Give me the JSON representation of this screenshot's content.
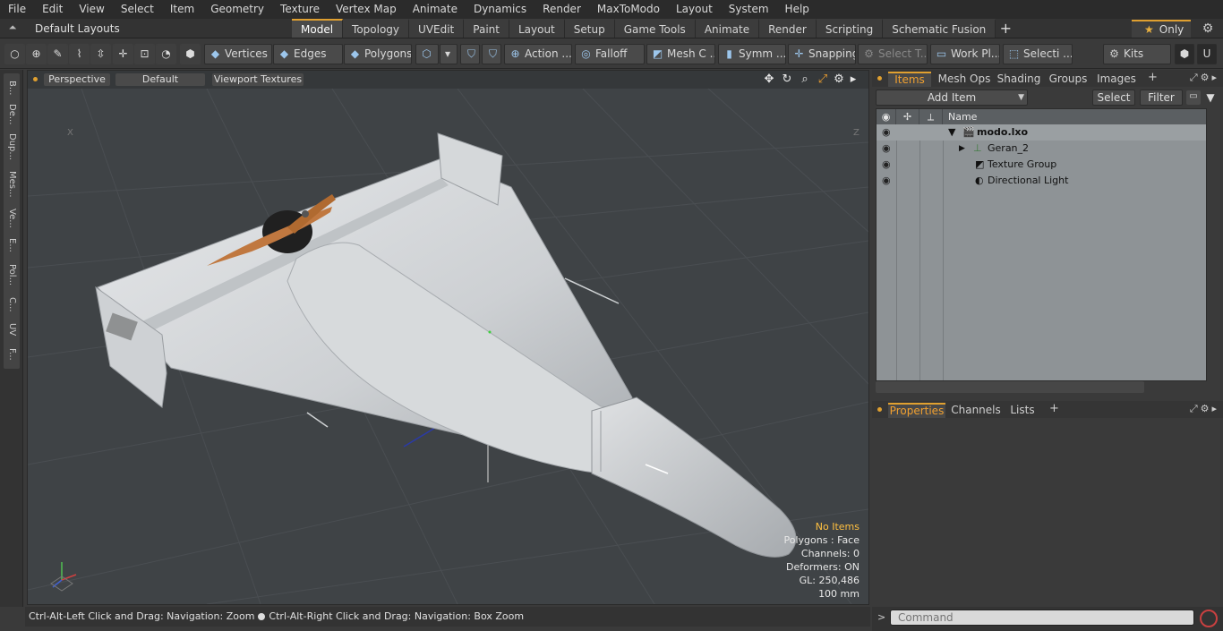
{
  "menu": [
    "File",
    "Edit",
    "View",
    "Select",
    "Item",
    "Geometry",
    "Texture",
    "Vertex Map",
    "Animate",
    "Dynamics",
    "Render",
    "MaxToModo",
    "Layout",
    "System",
    "Help"
  ],
  "layoutbar": {
    "layout_name": "Default Layouts ▾",
    "tabs": [
      "Model",
      "Topology",
      "UVEdit",
      "Paint",
      "Layout",
      "Setup",
      "Game Tools",
      "Animate",
      "Render",
      "Scripting",
      "Schematic Fusion"
    ],
    "active_tab": "Model",
    "only_label": "Only"
  },
  "toolbar": {
    "vertices": "Vertices",
    "edges": "Edges",
    "polygons": "Polygons",
    "action": "Action ...",
    "falloff": "Falloff",
    "mesh_c": "Mesh C ...",
    "symm": "Symm ...",
    "snapping": "Snapping",
    "select_t": "Select T...",
    "work_pl": "Work Pl...",
    "selecti": "Selecti ...",
    "kits": "Kits"
  },
  "left_tabs": [
    "B...",
    "De...",
    "Dup...",
    "Mes...",
    "Ve...",
    "E...",
    "Pol...",
    "C...",
    "UV",
    "F..."
  ],
  "viewport": {
    "view_mode": "Perspective",
    "shading": "Default",
    "textures": "Viewport Textures",
    "info": {
      "no_items": "No Items",
      "polygons": "Polygons : Face",
      "channels": "Channels: 0",
      "deformers": "Deformers: ON",
      "gl": "GL: 250,486",
      "scale": "100 mm"
    },
    "corner_x": "X",
    "corner_z": "Z"
  },
  "status": {
    "left": "Ctrl-Alt-Left Click and Drag: Navigation: Zoom",
    "right": "Ctrl-Alt-Right Click and Drag: Navigation: Box Zoom"
  },
  "items_panel": {
    "tabs": [
      "Items",
      "Mesh Ops",
      "Shading",
      "Groups",
      "Images"
    ],
    "add_item": "Add Item",
    "select": "Select",
    "filter": "Filter",
    "name_header": "Name",
    "rows": [
      "modo.lxo",
      "Geran_2",
      "Texture Group",
      "Directional Light"
    ]
  },
  "props_panel": {
    "tabs": [
      "Properties",
      "Channels",
      "Lists"
    ]
  },
  "command": {
    "placeholder": "Command"
  },
  "colors": {
    "accent": "#e0a030",
    "viewport_bg": "#3f4346",
    "list_bg": "#8e9396"
  }
}
